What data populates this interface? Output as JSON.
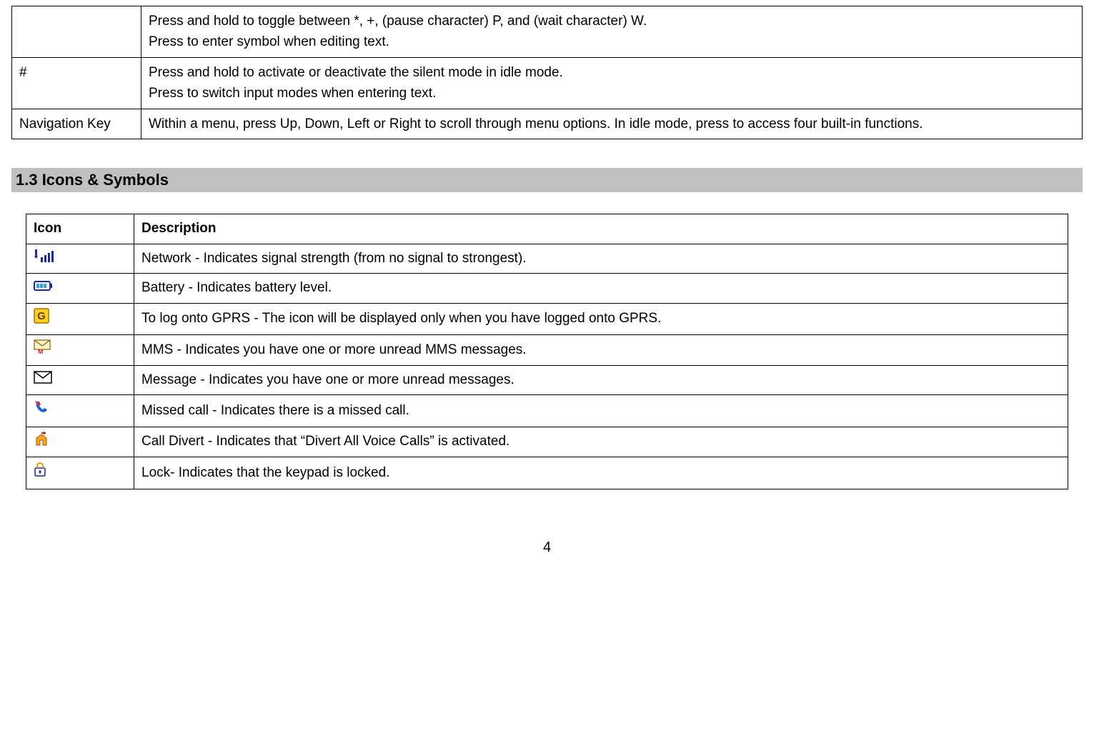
{
  "keys_table": {
    "rows": [
      {
        "key": "",
        "desc_lines": [
          "Press and hold to toggle between *, +, (pause character) P, and (wait character) W.",
          "Press to enter symbol when editing text."
        ]
      },
      {
        "key": "#",
        "desc_lines": [
          "Press and hold to activate or deactivate the silent mode in idle mode.",
          "Press to switch input modes when entering text."
        ]
      },
      {
        "key": "Navigation Key",
        "desc_lines": [
          "Within a menu, press Up, Down, Left or Right to scroll through menu options. In idle mode, press to access four built-in functions."
        ]
      }
    ]
  },
  "section_heading": "1.3 Icons & Symbols",
  "icons_table": {
    "headers": {
      "icon": "Icon",
      "description": "Description"
    },
    "rows": [
      {
        "icon_name": "signal-icon",
        "description": "Network - Indicates signal strength (from no signal to strongest)."
      },
      {
        "icon_name": "battery-icon",
        "description": "Battery - Indicates battery level."
      },
      {
        "icon_name": "gprs-icon",
        "description": "To log onto GPRS - The icon will be displayed only when you have logged onto GPRS."
      },
      {
        "icon_name": "mms-icon",
        "description": "MMS - Indicates you have one or more unread MMS messages."
      },
      {
        "icon_name": "message-icon",
        "description": "Message - Indicates you have one or more unread messages."
      },
      {
        "icon_name": "missed-call-icon",
        "description": "Missed call - Indicates there is a missed call."
      },
      {
        "icon_name": "call-divert-icon",
        "description": "Call Divert - Indicates that “Divert All Voice Calls” is activated."
      },
      {
        "icon_name": "lock-icon",
        "description": "Lock- Indicates that the keypad is locked."
      }
    ]
  },
  "page_number": "4"
}
